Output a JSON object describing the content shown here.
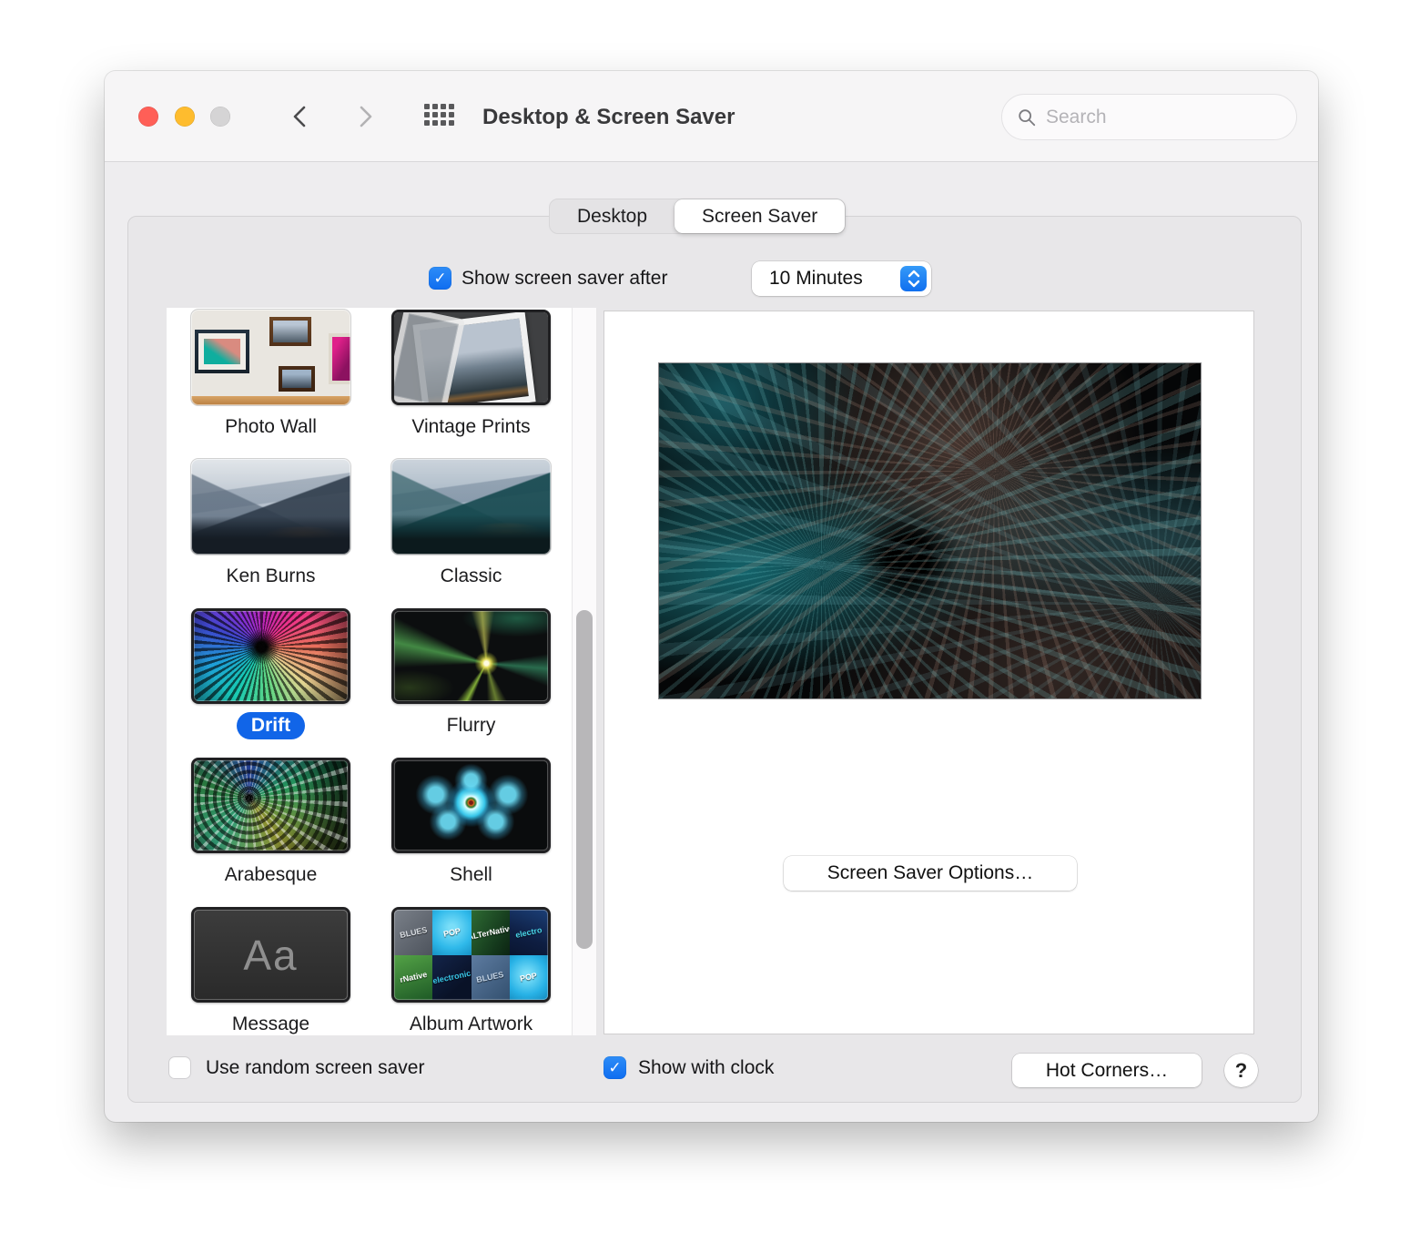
{
  "window": {
    "title": "Desktop & Screen Saver",
    "search_placeholder": "Search"
  },
  "tabs": {
    "items": [
      {
        "label": "Desktop",
        "selected": false
      },
      {
        "label": "Screen Saver",
        "selected": true
      }
    ]
  },
  "settings": {
    "show_after_label": "Show screen saver after",
    "show_after_checked": true,
    "delay_value": "10 Minutes"
  },
  "savers": {
    "message_sample": "Aa",
    "items": [
      {
        "label": "Photo Wall",
        "selected": false
      },
      {
        "label": "Vintage Prints",
        "selected": false
      },
      {
        "label": "Ken Burns",
        "selected": false
      },
      {
        "label": "Classic",
        "selected": false
      },
      {
        "label": "Drift",
        "selected": true
      },
      {
        "label": "Flurry",
        "selected": false
      },
      {
        "label": "Arabesque",
        "selected": false
      },
      {
        "label": "Shell",
        "selected": false
      },
      {
        "label": "Message",
        "selected": false
      },
      {
        "label": "Album Artwork",
        "selected": false
      }
    ],
    "album_tiles": [
      "BLUES",
      "POP",
      "ALTerNative",
      "electro",
      "rNative",
      "electronic",
      "BLUES",
      "POP"
    ]
  },
  "preview": {
    "options_button": "Screen Saver Options…"
  },
  "footer": {
    "random_label": "Use random screen saver",
    "random_checked": false,
    "clock_label": "Show with clock",
    "clock_checked": true,
    "hot_corners_button": "Hot Corners…",
    "help_label": "?"
  },
  "icons": {
    "checkmark": "✓"
  },
  "colors": {
    "accent_blue": "#187df4",
    "selection_blue": "#1165e8",
    "traffic_red": "#ff5f57",
    "traffic_yellow": "#febc2e"
  }
}
